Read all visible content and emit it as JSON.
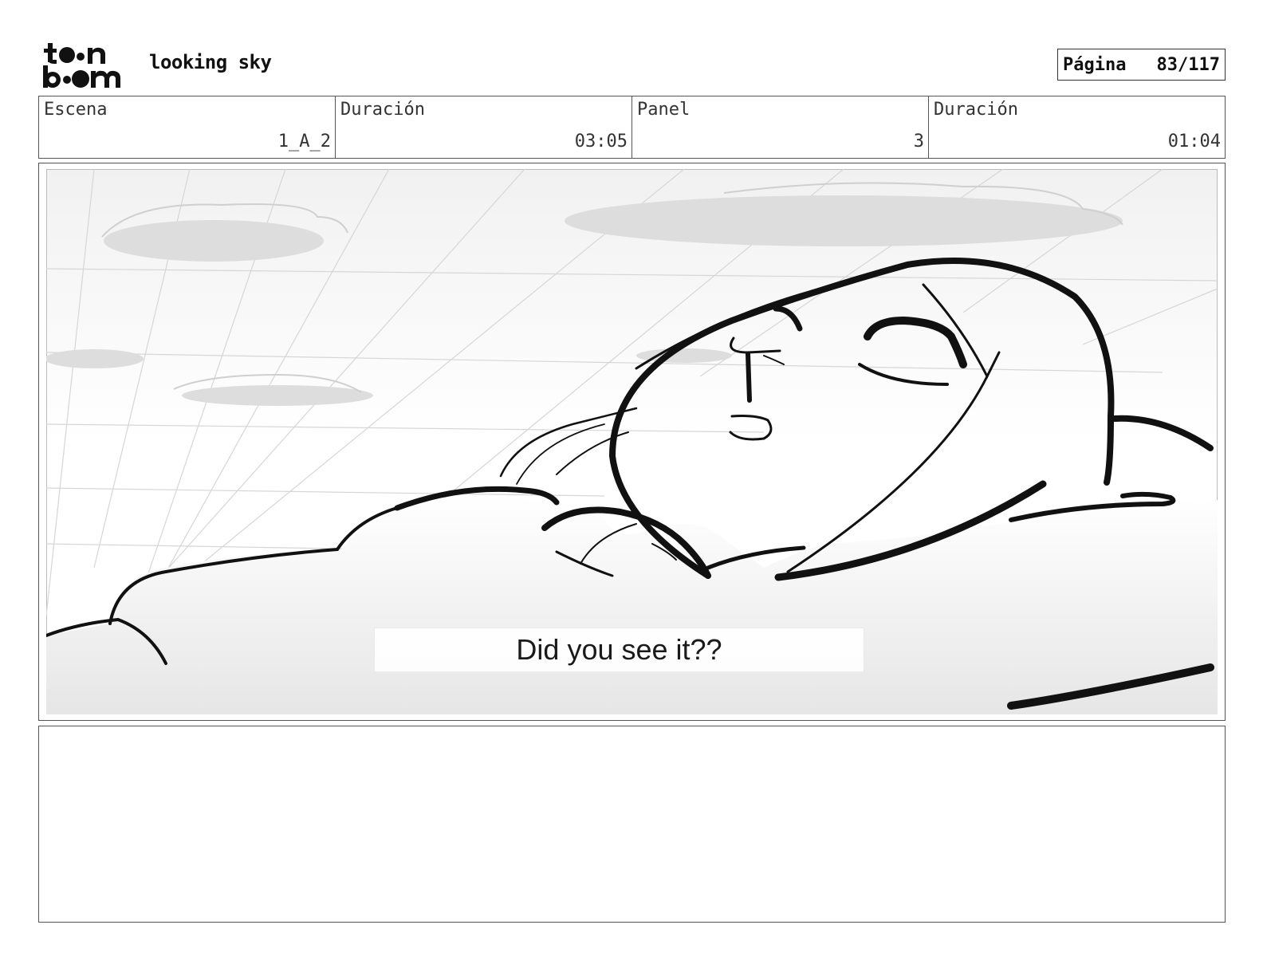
{
  "header": {
    "logo_text_top": "toon",
    "logo_text_bottom": "boom",
    "title": "looking sky",
    "page_label": "Página",
    "page_number": "83/117"
  },
  "info": {
    "scene_label": "Escena",
    "scene_value": "1_A_2",
    "scene_duration_label": "Duración",
    "scene_duration_value": "03:05",
    "panel_label": "Panel",
    "panel_value": "3",
    "panel_duration_label": "Duración",
    "panel_duration_value": "01:04"
  },
  "panel": {
    "illustration": "sketch-sleeping-character-icon",
    "caption": "Did you see it??"
  },
  "notes": {
    "text": ""
  }
}
